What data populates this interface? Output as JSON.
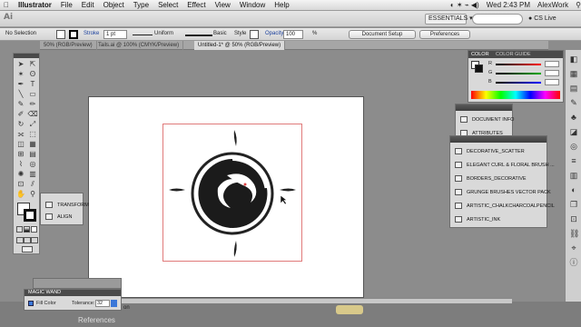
{
  "menubar": {
    "apple": "",
    "items": [
      "Illustrator",
      "File",
      "Edit",
      "Object",
      "Type",
      "Select",
      "Effect",
      "View",
      "Window",
      "Help"
    ],
    "clock": "Wed 2:43 PM",
    "user": "AlexWork"
  },
  "appbar": {
    "logo": "Ai",
    "workspace": "ESSENTIALS ▾",
    "cs_live": "CS Live"
  },
  "control": {
    "selection": "No Selection",
    "stroke_label": "Stroke",
    "stroke_value": "1 pt",
    "profile": "Uniform",
    "brush": "Basic",
    "style_label": "Style",
    "opacity_label": "Opacity",
    "opacity_value": "100",
    "opacity_unit": "%",
    "doc_setup": "Document Setup",
    "preferences": "Preferences",
    "fill_color": "#ffffff",
    "stroke_color": "#000000"
  },
  "tabs": [
    {
      "label": "50% (RGB/Preview)",
      "active": false
    },
    {
      "label": "Tails.ai @ 100% (CMYK/Preview)",
      "active": false
    },
    {
      "label": "Untitled-1* @ 50% (RGB/Preview)",
      "active": true
    }
  ],
  "color_panel": {
    "tab1": "COLOR",
    "tab2": "COLOR GUIDE",
    "channels": [
      "R",
      "G",
      "B"
    ]
  },
  "doc_panel": {
    "items": [
      "DOCUMENT INFO",
      "ATTRIBUTES"
    ]
  },
  "brush_panel": {
    "items": [
      "DECORATIVE_SCATTER",
      "ELEGANT CURL & FLORAL BRUSH ...",
      "BORDERS_DECORATIVE",
      "GRUNGE BRUSHES VECTOR PACK",
      "ARTISTIC_CHALKCHARCOALPENCIL",
      "ARTISTIC_INK"
    ]
  },
  "transform_panel": {
    "items": [
      "TRANSFORM",
      "ALIGN"
    ]
  },
  "magic_wand": {
    "title": "MAGIC WAND",
    "fill_color": "Fill Color",
    "tolerance_label": "Tolerance:",
    "tolerance_value": "32"
  },
  "bottom": {
    "references": "References",
    "on_text": "on"
  },
  "colors": {
    "accent": "#e07a7a",
    "panel_title": "#4a4a4a"
  }
}
